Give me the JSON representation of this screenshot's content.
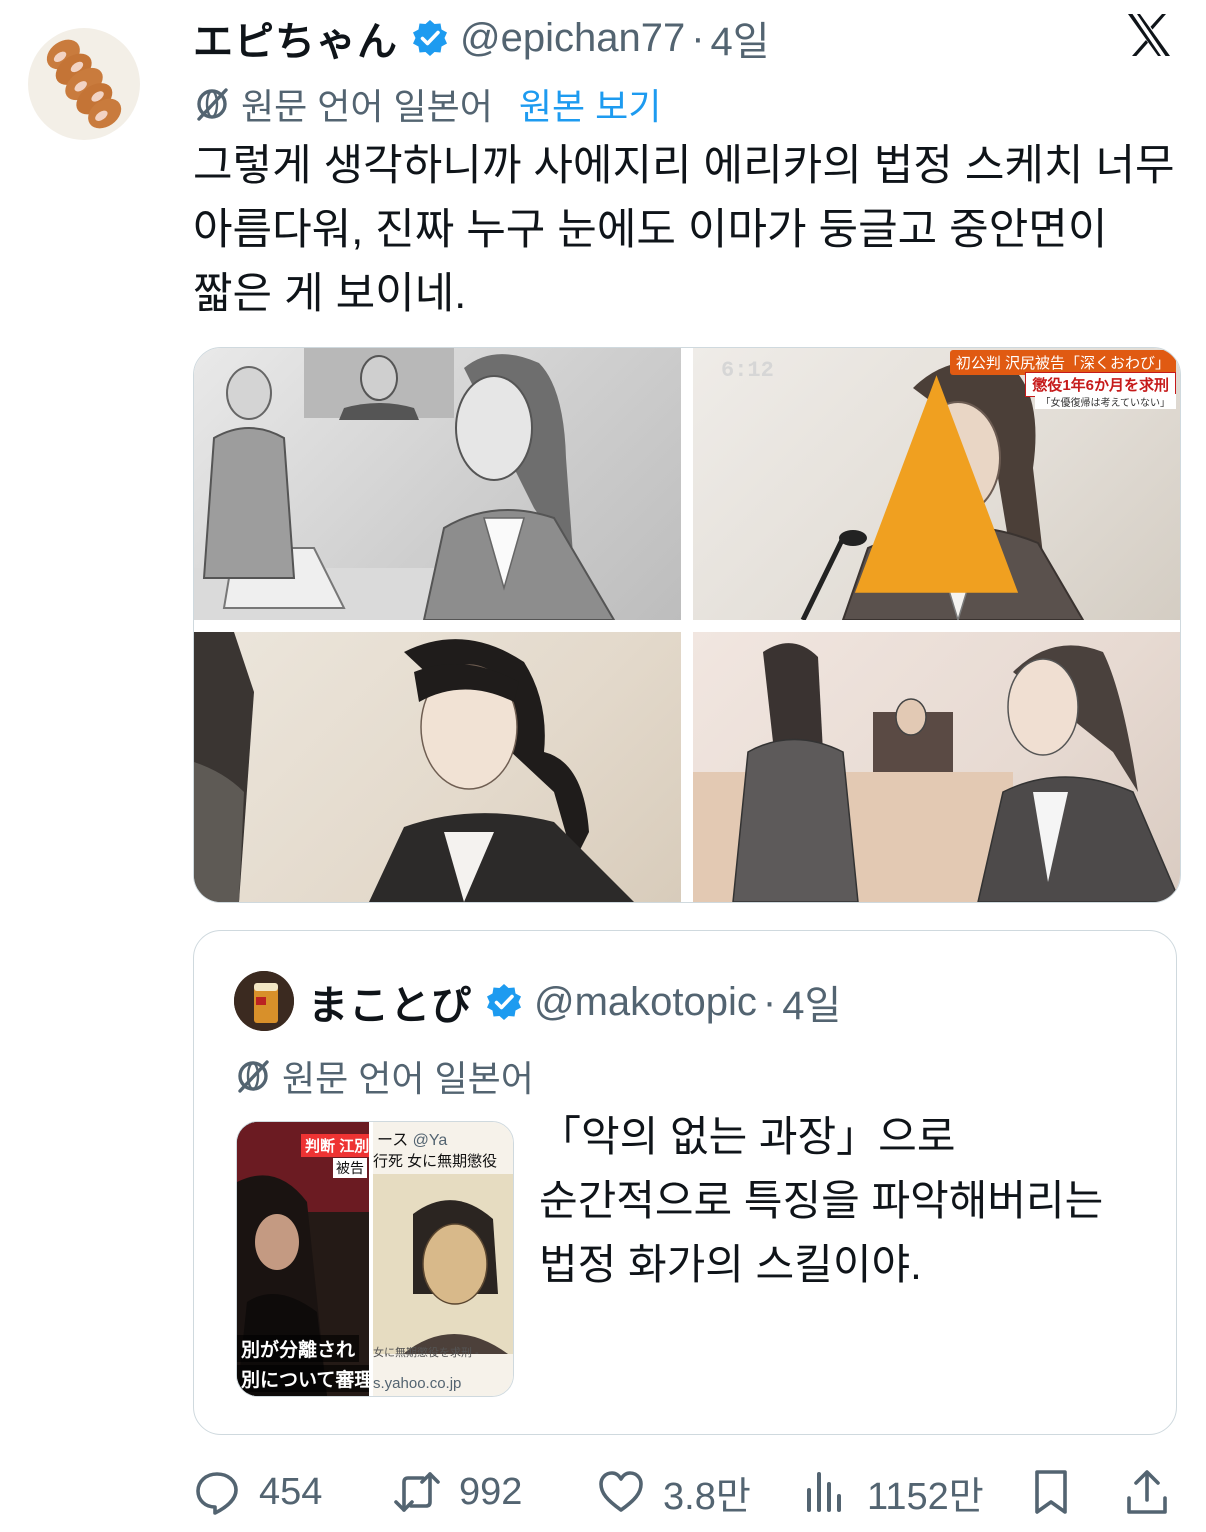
{
  "post": {
    "display_name": "エピちゃん",
    "handle": "@epichan77",
    "separator": "·",
    "time": "4일",
    "translation_label": "원문 언어 일본어",
    "view_original": "원본 보기",
    "text": "그렇게 생각하니까 사에지리 에리카의 법정 스케치 너무 아름다워, 진짜 누구 눈에도 이마가 둥글고 중안면이 짧은 게 보이네."
  },
  "media": {
    "tv_time": "6:12",
    "tv_banner_top": "初公判 沢尻被告「深くおわび」",
    "tv_banner_main": "懲役1年6か月を求刑",
    "tv_banner_sub": "「女優復帰は考えていない」"
  },
  "quote": {
    "display_name": "まことぴ",
    "handle": "@makotopic",
    "separator": "·",
    "time": "4일",
    "translation_label": "원문 언어 일본어",
    "text": "「악의 없는 과장」으로 순간적으로 특징을 파악해버리는 법정 화가의 스킬이야.",
    "thumb": {
      "left_tag": "判断",
      "left_tag2": "江別",
      "left_sub": "被告",
      "left_caption1": "別が分離され",
      "left_caption2": "別について審理進",
      "right_header": "ース",
      "right_handle": "@Ya",
      "right_title": "行死 女に無期懲役",
      "right_caption": "女に無期懲役を求刑 -",
      "right_url": "s.yahoo.co.jp"
    }
  },
  "actions": {
    "replies": "454",
    "retweets": "992",
    "likes": "3.8만",
    "views": "1152만"
  },
  "colors": {
    "accent": "#1d9bf0",
    "secondary_text": "#536471",
    "text": "#0f1419",
    "border": "#cfd9de"
  },
  "icons": [
    "x-logo-icon",
    "verified-badge-icon",
    "translate-icon",
    "reply-icon",
    "retweet-icon",
    "like-icon",
    "views-icon",
    "bookmark-icon",
    "share-icon"
  ]
}
